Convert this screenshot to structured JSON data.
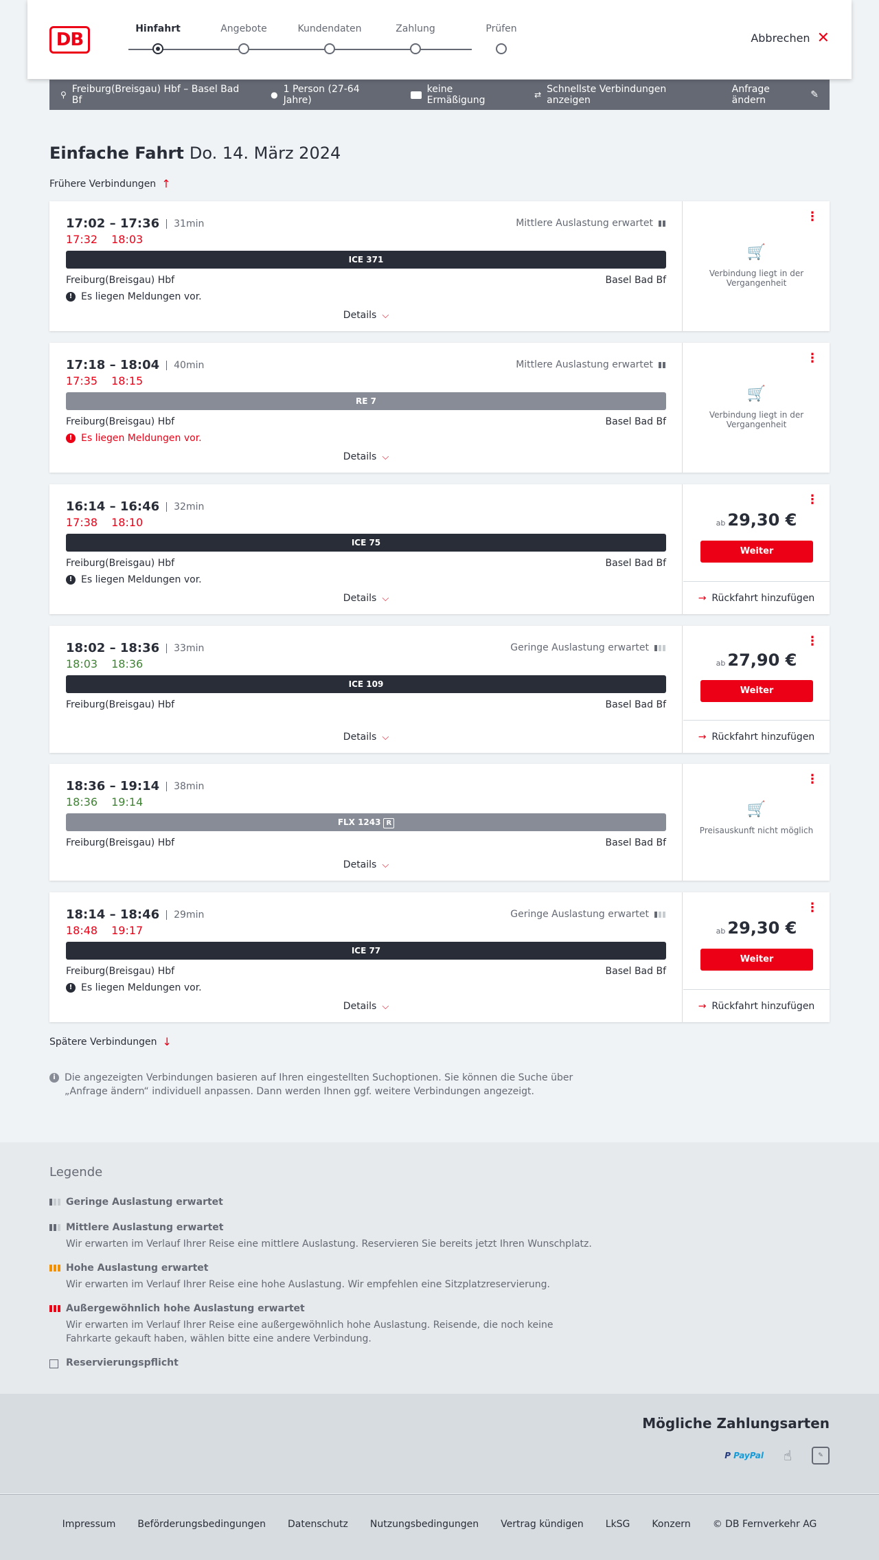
{
  "header": {
    "steps": [
      "Hinfahrt",
      "Angebote",
      "Kundendaten",
      "Zahlung",
      "Prüfen"
    ],
    "cancel_label": "Abbrechen",
    "logo": "DB"
  },
  "search": {
    "route": "Freiburg(Breisgau) Hbf – Basel Bad Bf",
    "persons": "1 Person (27-64 Jahre)",
    "discount": "keine Ermäßigung",
    "fastest": "Schnellste Verbindungen anzeigen",
    "edit": "Anfrage ändern"
  },
  "page": {
    "title_type": "Einfache Fahrt",
    "title_date": "Do. 14. März 2024",
    "earlier": "Frühere Verbindungen",
    "later": "Spätere Verbindungen",
    "info": "Die angezeigten Verbindungen basieren auf Ihren eingestellten Suchoptionen. Sie können die Suche über „Anfrage ändern“ individuell anpassen. Dann werden Ihnen ggf. weitere Verbindungen angezeigt."
  },
  "connections": [
    {
      "times": "17:02 – 17:36",
      "duration": "31min",
      "rt_dep": "17:32",
      "rt_arr": "18:03",
      "rt_status": "late",
      "load": "Mittlere Auslastung erwartet",
      "train": "ICE 371",
      "from": "Freiburg(Breisgau) Hbf",
      "to": "Basel Bad Bf",
      "message": "Es liegen Meldungen vor.",
      "details": "Details",
      "status_text": "Verbindung liegt in der Vergangenheit"
    },
    {
      "times": "17:18 – 18:04",
      "duration": "40min",
      "rt_dep": "17:35",
      "rt_arr": "18:15",
      "rt_status": "late",
      "load": "Mittlere Auslastung erwartet",
      "train": "RE 7",
      "from": "Freiburg(Breisgau) Hbf",
      "to": "Basel Bad Bf",
      "message": "Es liegen Meldungen vor.",
      "details": "Details",
      "status_text": "Verbindung liegt in der Vergangenheit"
    },
    {
      "times": "16:14 – 16:46",
      "duration": "32min",
      "rt_dep": "17:38",
      "rt_arr": "18:10",
      "rt_status": "late",
      "train": "ICE 75",
      "from": "Freiburg(Breisgau) Hbf",
      "to": "Basel Bad Bf",
      "message": "Es liegen Meldungen vor.",
      "details": "Details",
      "price_prefix": "ab",
      "price": "29,30 €",
      "button": "Weiter",
      "return_label": "Rückfahrt hinzufügen"
    },
    {
      "times": "18:02 – 18:36",
      "duration": "33min",
      "rt_dep": "18:03",
      "rt_arr": "18:36",
      "rt_status": "ontime",
      "load": "Geringe Auslastung erwartet",
      "train": "ICE 109",
      "from": "Freiburg(Breisgau) Hbf",
      "to": "Basel Bad Bf",
      "details": "Details",
      "price_prefix": "ab",
      "price": "27,90 €",
      "button": "Weiter",
      "return_label": "Rückfahrt hinzufügen"
    },
    {
      "times": "18:36 – 19:14",
      "duration": "38min",
      "rt_dep": "18:36",
      "rt_arr": "19:14",
      "rt_status": "ontime",
      "train": "FLX 1243",
      "train_badge": "R",
      "from": "Freiburg(Breisgau) Hbf",
      "to": "Basel Bad Bf",
      "details": "Details",
      "status_text": "Preisauskunft nicht möglich"
    },
    {
      "times": "18:14 – 18:46",
      "duration": "29min",
      "rt_dep": "18:48",
      "rt_arr": "19:17",
      "rt_status": "late",
      "load": "Geringe Auslastung erwartet",
      "train": "ICE 77",
      "from": "Freiburg(Breisgau) Hbf",
      "to": "Basel Bad Bf",
      "message": "Es liegen Meldungen vor.",
      "details": "Details",
      "price_prefix": "ab",
      "price": "29,30 €",
      "button": "Weiter",
      "return_label": "Rückfahrt hinzufügen"
    }
  ],
  "legend": {
    "title": "Legende",
    "low": "Geringe Auslastung erwartet",
    "medium": "Mittlere Auslastung erwartet",
    "medium_desc": "Wir erwarten im Verlauf Ihrer Reise eine mittlere Auslastung. Reservieren Sie bereits jetzt Ihren Wunschplatz.",
    "high": "Hohe Auslastung erwartet",
    "high_desc": "Wir erwarten im Verlauf Ihrer Reise eine hohe Auslastung. Wir empfehlen eine Sitzplatzreservierung.",
    "extreme": "Außergewöhnlich hohe Auslastung erwartet",
    "extreme_desc": "Wir erwarten im Verlauf Ihrer Reise eine außergewöhnlich hohe Auslastung. Reisende, die noch keine Fahrkarte gekauft haben, wählen bitte eine andere Verbindung.",
    "reservation": "Reservierungspflicht"
  },
  "payment": {
    "title": "Mögliche Zahlungsarten",
    "paypal": "PayPal"
  },
  "footer": {
    "links": [
      "Impressum",
      "Beförderungsbedingungen",
      "Datenschutz",
      "Nutzungsbedingungen",
      "Vertrag kündigen",
      "LkSG",
      "Konzern",
      "© DB Fernverkehr AG"
    ]
  },
  "colors": {
    "brand": "#ec0016",
    "late": "#ec0016",
    "ontime": "#408335",
    "dark": "#282d37"
  }
}
